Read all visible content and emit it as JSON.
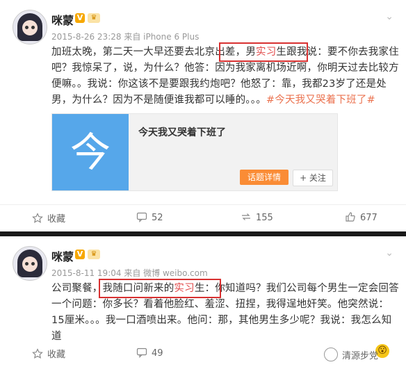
{
  "post1": {
    "name": "咪蒙",
    "v_badge": "V",
    "crown": "♛",
    "meta": "2015-8-26 23:28 来自 iPhone 6 Plus",
    "body": {
      "p1": "加班太晚，第二天一大早还要去北京出差，",
      "hl1": "男",
      "hl2": "实习",
      "p1b": "生跟我说",
      "p2": "：要不你去我家住吧？我惊呆了，说，为什么？他答：因为我家离机场近啊，你明天过去比较方便嘛。。我说：你这该不是要跟我约炮吧？他怒了：靠，我都23岁了还是处男，为什么？因为不是随便谁我都可以睡的。。。",
      "topic": "#今天我又哭着下班了#"
    },
    "card": {
      "thumb_char": "今",
      "title": "今天我又哭着下班了",
      "detail_button": "话题详情",
      "follow_button": "+ 关注"
    },
    "actions": {
      "repost": "收藏",
      "comments": "52",
      "reposts": "155",
      "likes": "677"
    }
  },
  "post2": {
    "name": "咪蒙",
    "v_badge": "V",
    "crown": "♛",
    "meta": "2015-8-11 19:04 来自 微博 weibo.com",
    "body": {
      "p1": "公司聚餐，",
      "boxed": "我随口问新来的",
      "hl": "实习",
      "boxed2": "生：",
      "p2": "你知道吗？我们公司每个男生一定会回答一个问题：你多长？看着他脸红、羞涩、扭捏，我得逞地奸笑。他突然说：15厘米。。。我一口酒喷出来。他问：那，其他男生多少呢？我说：我怎么知道"
    },
    "actions": {
      "repost": "收藏",
      "comments": "49"
    },
    "emoji": "😮"
  },
  "watermark": "清源步党",
  "icons": [
    "chevron-down-icon",
    "star-icon",
    "comment-icon",
    "repost-icon",
    "like-icon",
    "wechat-icon"
  ],
  "colors": {
    "highlight": "#e24a4a",
    "topic": "#eb7350",
    "box": "#d83030",
    "detail_button": "#fa8c35",
    "thumb": "#56a7ea"
  }
}
